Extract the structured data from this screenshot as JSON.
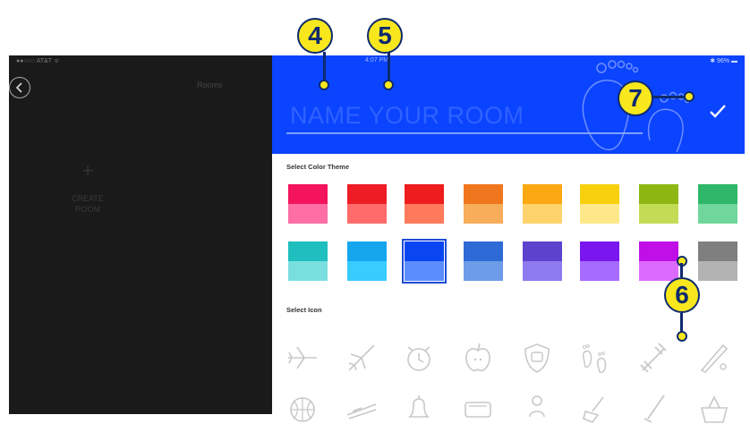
{
  "status_bar": {
    "left": "●●○○○ AT&T ᯤ",
    "time": "4:07 PM",
    "right": "✱ 96% ▬"
  },
  "left_pane": {
    "title": "Rooms",
    "create_room": {
      "plus": "+",
      "label_line1": "CREATE",
      "label_line2": "ROOM"
    }
  },
  "header": {
    "room_name_placeholder": "NAME YOUR ROOM",
    "bg_color": "#0b44ff"
  },
  "color_section": {
    "label": "Select Color Theme",
    "rows": [
      [
        {
          "top": "#f4145c",
          "bottom": "#ff6fa6"
        },
        {
          "top": "#ee1c25",
          "bottom": "#ff6a6a"
        },
        {
          "top": "#ee1c1c",
          "bottom": "#ff7a5a"
        },
        {
          "top": "#f0761e",
          "bottom": "#f7ad5a"
        },
        {
          "top": "#fba813",
          "bottom": "#ffd36b"
        },
        {
          "top": "#f9d00e",
          "bottom": "#ffe88a"
        },
        {
          "top": "#8fb714",
          "bottom": "#c2dd55"
        },
        {
          "top": "#2fb769",
          "bottom": "#6fd79b"
        }
      ],
      [
        {
          "top": "#1ebfbe",
          "bottom": "#79dfde"
        },
        {
          "top": "#15a6ee",
          "bottom": "#38ccff"
        },
        {
          "top": "#0a45f2",
          "bottom": "#5c8dff",
          "selected": true
        },
        {
          "top": "#2e6ad6",
          "bottom": "#6d9ce8"
        },
        {
          "top": "#5c42cc",
          "bottom": "#8f7bf0"
        },
        {
          "top": "#7a16ee",
          "bottom": "#a66bff"
        },
        {
          "top": "#c10fe8",
          "bottom": "#dd6aff"
        },
        {
          "top": "#7f7f7f",
          "bottom": "#b3b3b3"
        }
      ]
    ]
  },
  "icon_section": {
    "label": "Select Icon",
    "row1": [
      "airplane-icon",
      "plane-takeoff-icon",
      "alarm-clock-icon",
      "apple-icon",
      "shield-icon",
      "baby-feet-icon",
      "barbell-icon",
      "baseball-bat-icon"
    ],
    "row2": [
      "basketball-icon",
      "bed-icon",
      "bell-icon",
      "bathtub-icon",
      "person-icon",
      "broom-icon",
      "brush-icon",
      "basket-icon"
    ]
  },
  "callouts": {
    "c4": "4",
    "c5": "5",
    "c6": "6",
    "c7": "7"
  }
}
